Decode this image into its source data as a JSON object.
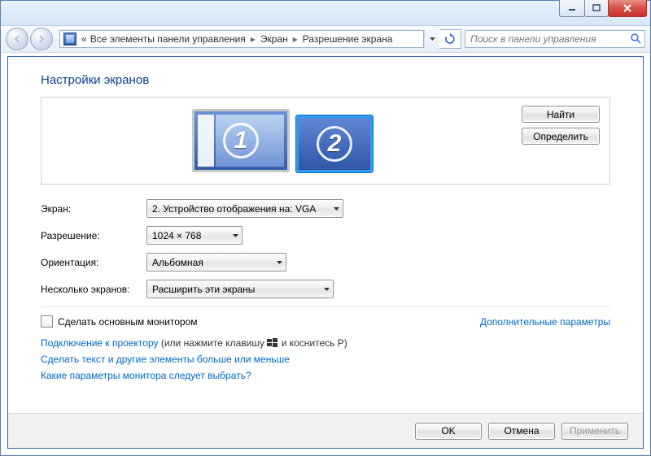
{
  "breadcrumb": {
    "prefix": "«",
    "items": [
      "Все элементы панели управления",
      "Экран",
      "Разрешение экрана"
    ]
  },
  "search": {
    "placeholder": "Поиск в панели управления"
  },
  "title": "Настройки экранов",
  "monitors": [
    {
      "num": "1",
      "selected": false
    },
    {
      "num": "2",
      "selected": true
    }
  ],
  "buttons": {
    "find": "Найти",
    "identify": "Определить",
    "ok": "OK",
    "cancel": "Отмена",
    "apply": "Применить"
  },
  "labels": {
    "display": "Экран:",
    "resolution": "Разрешение:",
    "orientation": "Ориентация:",
    "multi": "Несколько экранов:"
  },
  "values": {
    "display": "2. Устройство отображения на: VGA",
    "resolution": "1024 × 768",
    "orientation": "Альбомная",
    "multi": "Расширить эти экраны"
  },
  "checkbox": {
    "label": "Сделать основным монитором"
  },
  "links": {
    "advanced": "Дополнительные параметры",
    "projector_a": "Подключение к проектору",
    "projector_b": "(или нажмите клавишу",
    "projector_c": "и коснитесь P)",
    "textsize": "Сделать текст и другие элементы больше или меньше",
    "which": "Какие параметры монитора следует выбрать?"
  }
}
